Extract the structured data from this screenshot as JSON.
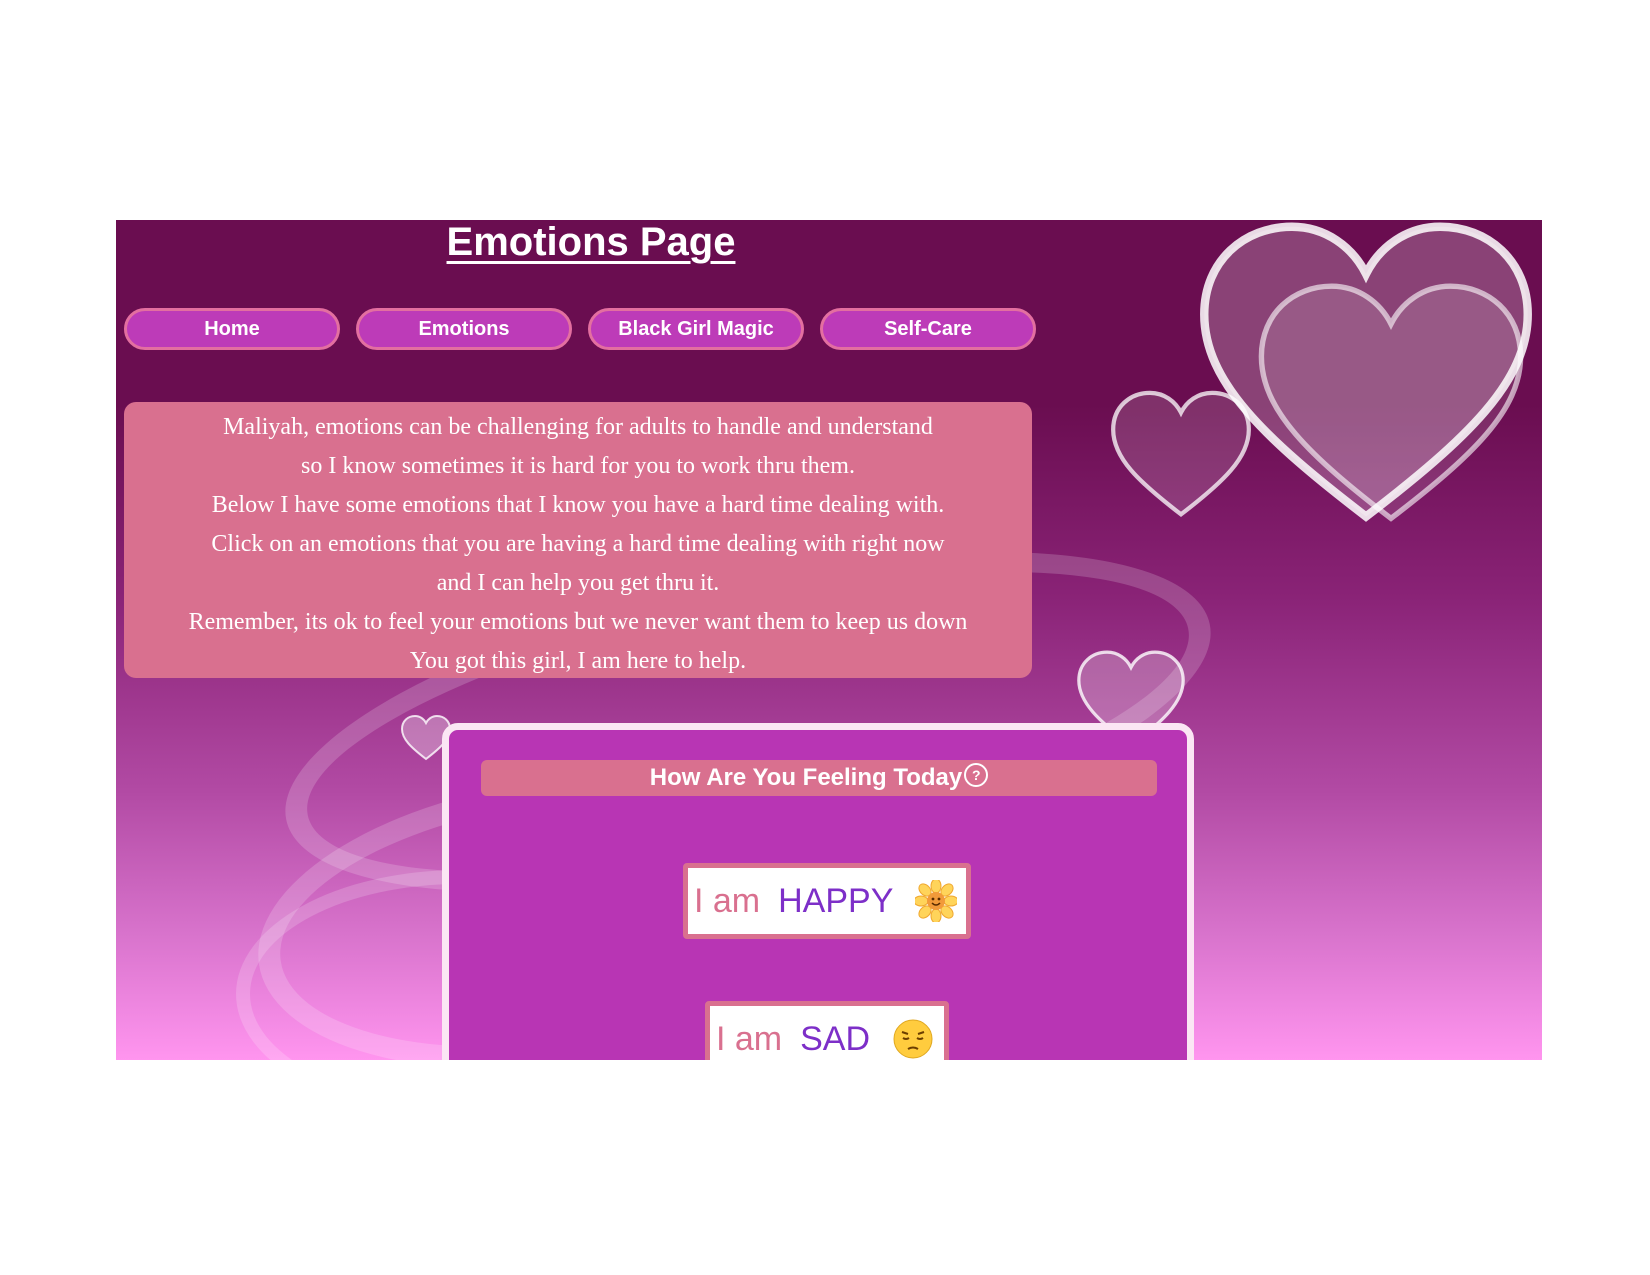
{
  "page": {
    "title": "Emotions Page"
  },
  "nav": [
    {
      "label": "Home"
    },
    {
      "label": "Emotions"
    },
    {
      "label": "Black Girl Magic"
    },
    {
      "label": "Self-Care"
    }
  ],
  "intro": {
    "lines": [
      "Maliyah, emotions can be challenging for adults to handle and understand",
      "so I know sometimes it is hard for you to work thru them.",
      "Below I have some emotions that I know you have a hard time dealing with.",
      "Click on an emotions that you are having a hard time dealing with right now",
      "and I can help you get thru it.",
      "Remember, its ok to feel your emotions but we never want them to keep us down",
      "You got this girl, I am here to help."
    ]
  },
  "panel": {
    "header": "How Are You Feeling Today",
    "header_icon": "question-icon",
    "buttons": [
      {
        "prefix": "I am",
        "word": "HAPPY",
        "icon": "sunflower-icon"
      },
      {
        "prefix": "I am",
        "word": "SAD",
        "icon": "pensive-face-icon"
      }
    ]
  },
  "colors": {
    "background_top": "#6a0d50",
    "background_bottom": "#ff95ef",
    "nav_button": "#bd3bb8",
    "nav_border": "#e36fa0",
    "intro_box": "#d9708f",
    "panel": "#b835b4",
    "emotion_word": "#7d2fc8"
  }
}
